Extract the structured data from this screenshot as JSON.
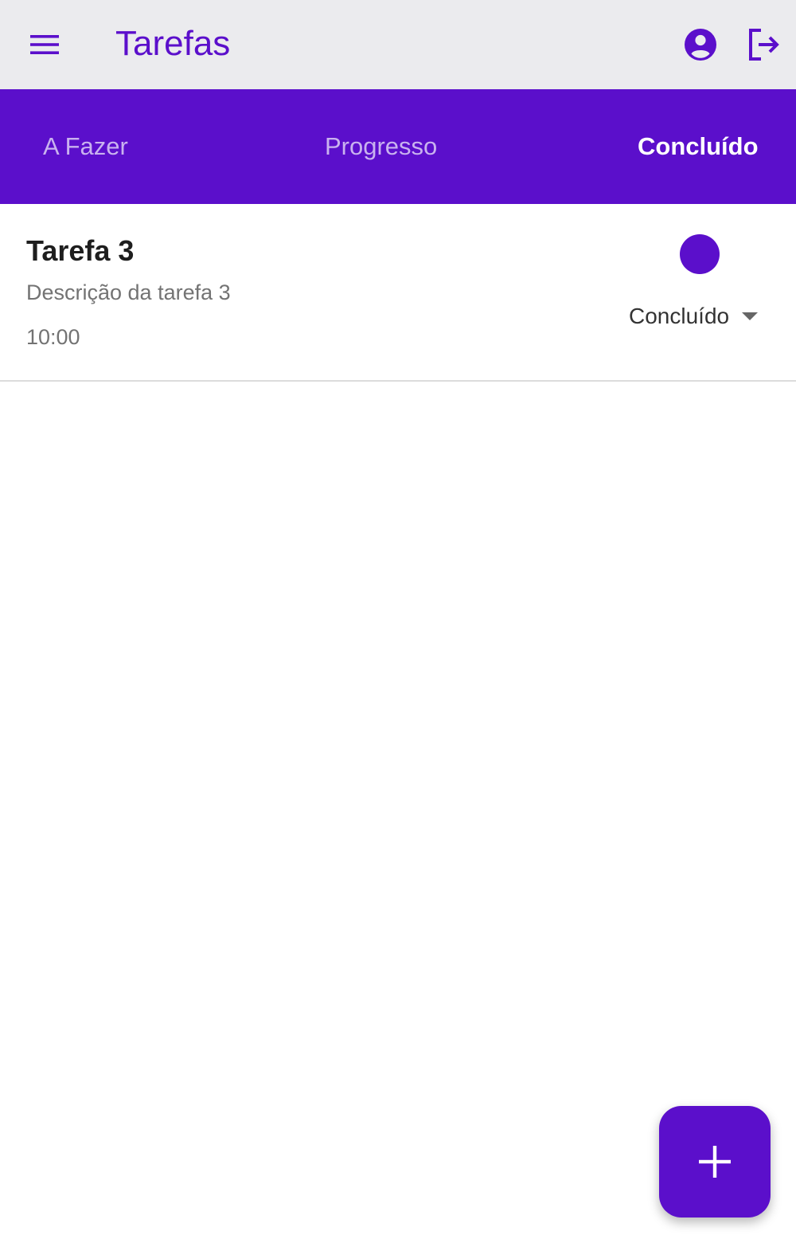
{
  "app_bar": {
    "title": "Tarefas",
    "menu_icon": "menu-icon",
    "account_icon": "account-circle-icon",
    "logout_icon": "logout-icon"
  },
  "tabs": [
    {
      "label": "A Fazer",
      "active": false
    },
    {
      "label": "Progresso",
      "active": false
    },
    {
      "label": "Concluído",
      "active": true
    }
  ],
  "tasks": [
    {
      "title": "Tarefa 3",
      "description": "Descrição da tarefa 3",
      "time": "10:00",
      "status": "Concluído",
      "status_color": "#5b0fcb"
    }
  ],
  "fab": {
    "icon": "plus-icon"
  },
  "colors": {
    "primary": "#5b0fcb",
    "app_bar_bg": "#ebebee",
    "inactive_tab": "#c9b2ef"
  }
}
